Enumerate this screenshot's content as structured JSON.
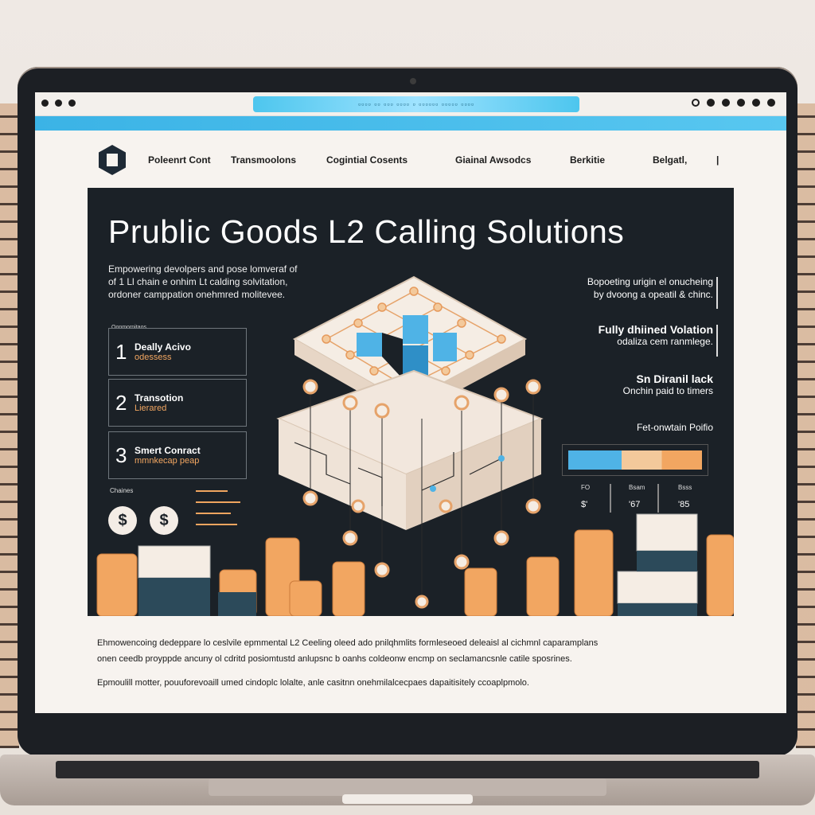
{
  "browser": {
    "url": "▫▫▫▫ ▫▫ ▫▫▫ ▫▫▫▫ ▫ ▫▫▫▫▫▫ ▫▫▫▫▫ ▫▫▫▫"
  },
  "nav": {
    "items": [
      "Poleenrt Cont",
      "Transmoolons",
      "Cogintial Cosents",
      "Giainal Awsodcs",
      "Berkitie",
      "Belgatl,",
      "|"
    ]
  },
  "hero": {
    "title": "Prublic Goods L2 Calling Solutions",
    "subtitle_lines": [
      "Empowering devolpers and pose lomveraf of",
      "of 1 Ll chain e onhim Lt calding solvitation,",
      "ordoner camppation onehmred molitevee."
    ],
    "steps_tag": "Oonmornitaos",
    "steps": [
      {
        "num": "1",
        "title": "Deally Acivo",
        "sub": "odessess"
      },
      {
        "num": "2",
        "title": "Transotion",
        "sub": "Lierared"
      },
      {
        "num": "3",
        "title": "Smert Conract",
        "sub": "mmnkecap peap"
      }
    ],
    "chains_label": "Chaines",
    "currency_symbol": "$",
    "right_blocks": [
      {
        "lines": [
          "Bopoeting urigin el onucheing",
          "by dvoong a opeatil & chinc."
        ]
      },
      {
        "head": "Fully dhiined Volation",
        "sub": "odaliza cem ranmlege."
      },
      {
        "head": "Sn Diranil lack",
        "sub": "Onchin paid to timers"
      },
      {
        "head": "Fet-onwtain Poifio"
      }
    ],
    "stats": [
      {
        "label": "FO",
        "value": "$'"
      },
      {
        "label": "Bsam",
        "value": "'67"
      },
      {
        "label": "Bsss",
        "value": "'85"
      }
    ],
    "colors": {
      "accent_blue": "#4fb3e6",
      "accent_orange": "#f2a661",
      "panel": "#1b2127"
    }
  },
  "footer": {
    "lines": [
      "Ehmowencoing dedeppare lo ceslvile epmmental L2 Ceeling oleed ado pnilqhmlits formleseoed deleaisl al cichmnl caparamplans",
      "onen ceedb proyppde ancuny ol cdritd posiomtustd anlupsnc b oanhs coldeonw encmp on seclamancsnle catile sposrines.",
      "Epmoulill motter, pouuforevoaill umed cindoplc lolalte, anle casitnn onehmilalcecpaes dapaitisitely ccoaplpmolo."
    ]
  }
}
